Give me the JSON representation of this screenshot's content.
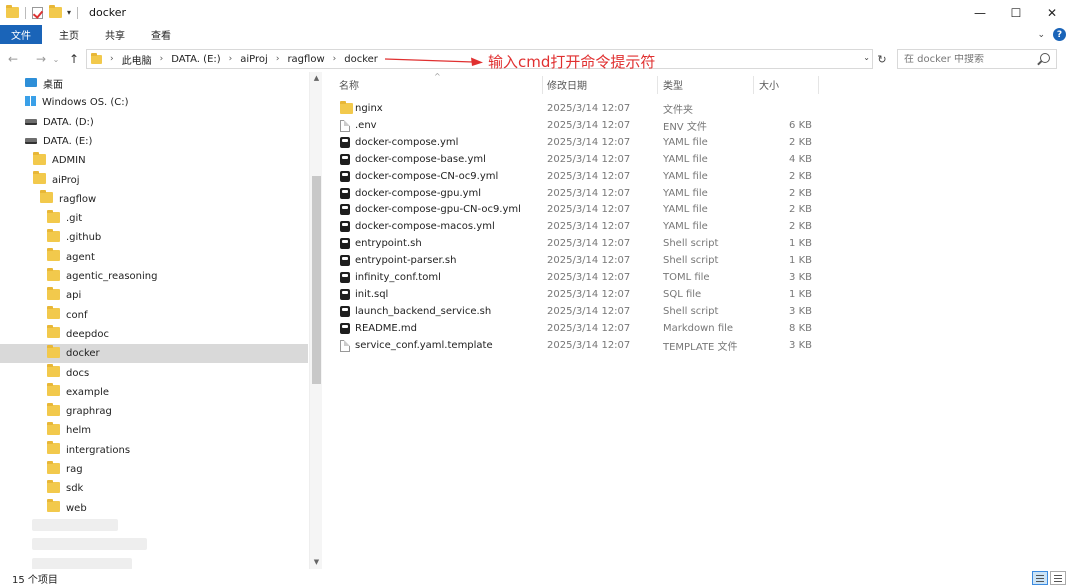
{
  "window": {
    "title": "docker",
    "minimize_glyph": "—",
    "maximize_glyph": "☐",
    "close_glyph": "✕"
  },
  "ribbon": {
    "tabs": [
      {
        "label": "文件"
      },
      {
        "label": "主页"
      },
      {
        "label": "共享"
      },
      {
        "label": "查看"
      }
    ]
  },
  "address": {
    "breadcrumbs": [
      "此电脑",
      "DATA. (E:)",
      "aiProj",
      "ragflow",
      "docker"
    ],
    "search_placeholder": "在 docker 中搜索"
  },
  "annotation": {
    "text": "输入cmd打开命令提示符",
    "color": "#e03030"
  },
  "nav_pane": {
    "items": [
      {
        "label": "桌面",
        "icon": "desktop-icon",
        "level": 0
      },
      {
        "label": "Windows OS. (C:)",
        "icon": "windows-drive-icon",
        "level": 0
      },
      {
        "label": "DATA. (D:)",
        "icon": "drive-icon",
        "level": 0
      },
      {
        "label": "DATA. (E:)",
        "icon": "drive-icon",
        "level": 0
      },
      {
        "label": "ADMIN",
        "icon": "folder-icon",
        "level": 1
      },
      {
        "label": "aiProj",
        "icon": "folder-icon",
        "level": 1
      },
      {
        "label": "ragflow",
        "icon": "folder-icon",
        "level": 2
      },
      {
        "label": ".git",
        "icon": "folder-icon",
        "level": 3
      },
      {
        "label": ".github",
        "icon": "folder-icon",
        "level": 3
      },
      {
        "label": "agent",
        "icon": "folder-icon",
        "level": 3
      },
      {
        "label": "agentic_reasoning",
        "icon": "folder-icon",
        "level": 3
      },
      {
        "label": "api",
        "icon": "folder-icon",
        "level": 3
      },
      {
        "label": "conf",
        "icon": "folder-icon",
        "level": 3
      },
      {
        "label": "deepdoc",
        "icon": "folder-icon",
        "level": 3
      },
      {
        "label": "docker",
        "icon": "folder-icon",
        "level": 3,
        "selected": true
      },
      {
        "label": "docs",
        "icon": "folder-icon",
        "level": 3
      },
      {
        "label": "example",
        "icon": "folder-icon",
        "level": 3
      },
      {
        "label": "graphrag",
        "icon": "folder-icon",
        "level": 3
      },
      {
        "label": "helm",
        "icon": "folder-icon",
        "level": 3
      },
      {
        "label": "intergrations",
        "icon": "folder-icon",
        "level": 3
      },
      {
        "label": "rag",
        "icon": "folder-icon",
        "level": 3
      },
      {
        "label": "sdk",
        "icon": "folder-icon",
        "level": 3
      },
      {
        "label": "web",
        "icon": "folder-icon",
        "level": 3
      }
    ]
  },
  "file_list": {
    "columns": [
      "名称",
      "修改日期",
      "类型",
      "大小"
    ],
    "rows": [
      {
        "name": "nginx",
        "date": "2025/3/14 12:07",
        "type": "文件夹",
        "size": "",
        "icon": "folder-icon"
      },
      {
        "name": ".env",
        "date": "2025/3/14 12:07",
        "type": "ENV 文件",
        "size": "6 KB",
        "icon": "file-icon"
      },
      {
        "name": "docker-compose.yml",
        "date": "2025/3/14 12:07",
        "type": "YAML file",
        "size": "2 KB",
        "icon": "app-file-icon"
      },
      {
        "name": "docker-compose-base.yml",
        "date": "2025/3/14 12:07",
        "type": "YAML file",
        "size": "4 KB",
        "icon": "app-file-icon"
      },
      {
        "name": "docker-compose-CN-oc9.yml",
        "date": "2025/3/14 12:07",
        "type": "YAML file",
        "size": "2 KB",
        "icon": "app-file-icon"
      },
      {
        "name": "docker-compose-gpu.yml",
        "date": "2025/3/14 12:07",
        "type": "YAML file",
        "size": "2 KB",
        "icon": "app-file-icon"
      },
      {
        "name": "docker-compose-gpu-CN-oc9.yml",
        "date": "2025/3/14 12:07",
        "type": "YAML file",
        "size": "2 KB",
        "icon": "app-file-icon"
      },
      {
        "name": "docker-compose-macos.yml",
        "date": "2025/3/14 12:07",
        "type": "YAML file",
        "size": "2 KB",
        "icon": "app-file-icon"
      },
      {
        "name": "entrypoint.sh",
        "date": "2025/3/14 12:07",
        "type": "Shell script",
        "size": "1 KB",
        "icon": "app-file-icon"
      },
      {
        "name": "entrypoint-parser.sh",
        "date": "2025/3/14 12:07",
        "type": "Shell script",
        "size": "1 KB",
        "icon": "app-file-icon"
      },
      {
        "name": "infinity_conf.toml",
        "date": "2025/3/14 12:07",
        "type": "TOML file",
        "size": "3 KB",
        "icon": "app-file-icon"
      },
      {
        "name": "init.sql",
        "date": "2025/3/14 12:07",
        "type": "SQL file",
        "size": "1 KB",
        "icon": "app-file-icon"
      },
      {
        "name": "launch_backend_service.sh",
        "date": "2025/3/14 12:07",
        "type": "Shell script",
        "size": "3 KB",
        "icon": "app-file-icon"
      },
      {
        "name": "README.md",
        "date": "2025/3/14 12:07",
        "type": "Markdown file",
        "size": "8 KB",
        "icon": "app-file-icon"
      },
      {
        "name": "service_conf.yaml.template",
        "date": "2025/3/14 12:07",
        "type": "TEMPLATE 文件",
        "size": "3 KB",
        "icon": "file-icon"
      }
    ]
  },
  "status": {
    "item_count": "15 个项目"
  }
}
